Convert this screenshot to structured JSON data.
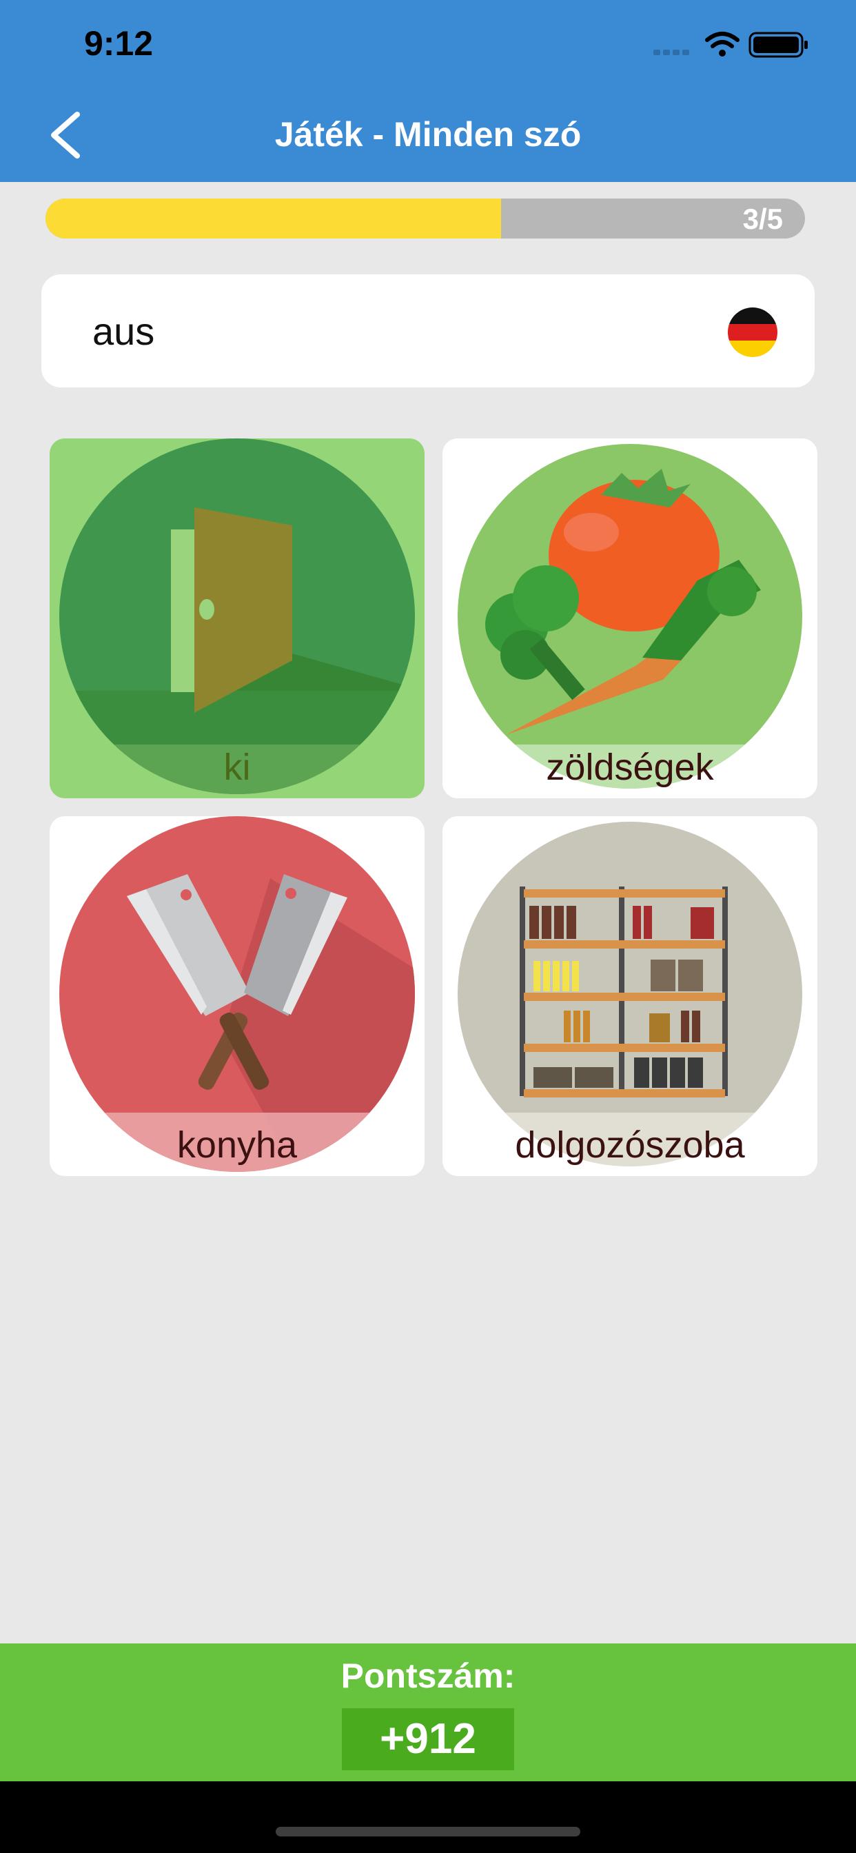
{
  "status_bar": {
    "time": "9:12"
  },
  "nav": {
    "title": "Játék - Minden szó",
    "back_icon": "chevron-left-icon"
  },
  "progress": {
    "current": 3,
    "total": 5,
    "fraction": 0.6,
    "label": "3/5"
  },
  "word": {
    "text": "aus",
    "language_flag": "germany-flag-icon"
  },
  "options": [
    {
      "label": "ki",
      "image": "open-door",
      "selected": true
    },
    {
      "label": "zöldségek",
      "image": "vegetables",
      "selected": false
    },
    {
      "label": "konyha",
      "image": "cleavers",
      "selected": false
    },
    {
      "label": "dolgozószoba",
      "image": "bookshelf",
      "selected": false
    }
  ],
  "score": {
    "title": "Pontszám:",
    "value": "+912"
  },
  "colors": {
    "header": "#3a8ad4",
    "progress_fill": "#fcdb35",
    "selected_card": "#93d577",
    "score_bar": "#67c23d",
    "score_box": "#4aab1e"
  }
}
